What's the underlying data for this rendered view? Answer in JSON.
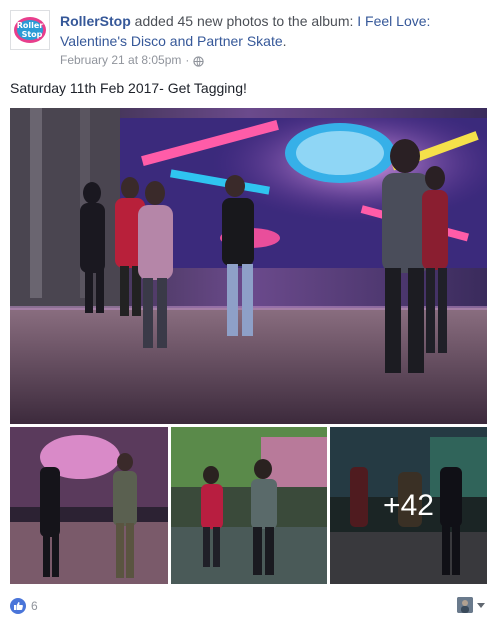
{
  "post": {
    "page_name": "RollerStop",
    "action_text": " added 45 new photos to the album: ",
    "album_title": "I Feel Love: Valentine's Disco and Partner Skate",
    "album_suffix": ".",
    "timestamp": "February 21 at 8:05pm",
    "separator": "·",
    "privacy_icon": "globe-icon",
    "message": "Saturday 11th Feb 2017- Get Tagging!"
  },
  "logo": {
    "line1": "Roller",
    "line2": "Stop"
  },
  "photos": {
    "more_count": "+42",
    "items": [
      {
        "name": "main-photo"
      },
      {
        "name": "photo-2"
      },
      {
        "name": "photo-3"
      },
      {
        "name": "photo-4"
      }
    ]
  },
  "reactions": {
    "icon": "like-icon",
    "count": "6"
  },
  "colors": {
    "link": "#365899",
    "meta": "#90949c",
    "like": "#4a75d9"
  }
}
